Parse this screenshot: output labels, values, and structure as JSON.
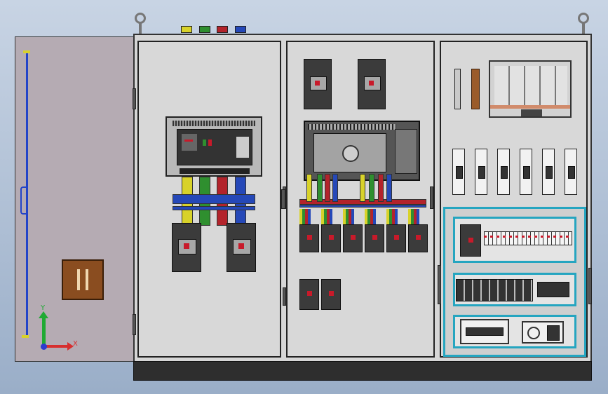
{
  "axis_triad": {
    "y_label": "Y",
    "x_label": "X"
  },
  "colors": {
    "phase_yellow": "#d8d22a",
    "phase_green": "#2f8f2f",
    "phase_red": "#b3232b",
    "phase_blue": "#2548b8",
    "enclosure_gray": "#d6d6d6",
    "door_mauve": "#b5abb3",
    "din_teal": "#25a5c0",
    "handle_brown": "#8a4d20"
  },
  "icons": [
    "lifting-eye-icon",
    "axis-triad-icon",
    "door-handle-icon"
  ]
}
